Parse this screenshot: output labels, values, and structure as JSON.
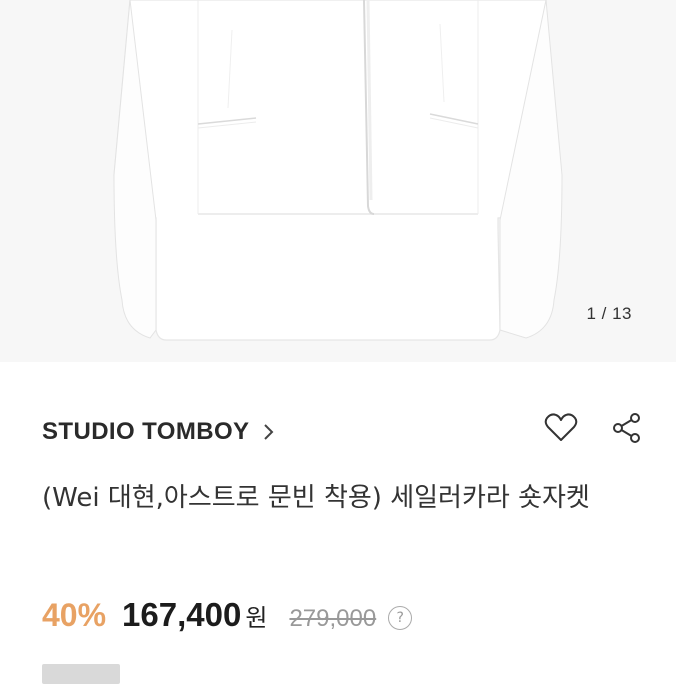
{
  "gallery": {
    "counter": "1 / 13"
  },
  "product": {
    "brand": "STUDIO TOMBOY",
    "title": "(Wei 대현,아스트로 문빈 착용) 세일러카라 숏자켓",
    "discount": "40%",
    "price": "167,400",
    "currency": "원",
    "original_price": "279,000"
  },
  "icons": {
    "brand_link": "chevron-right-icon",
    "wishlist": "heart-icon",
    "share": "share-icon",
    "price_info": "question-icon"
  },
  "colors": {
    "discount": "#e8a264",
    "background": "#ffffff"
  }
}
